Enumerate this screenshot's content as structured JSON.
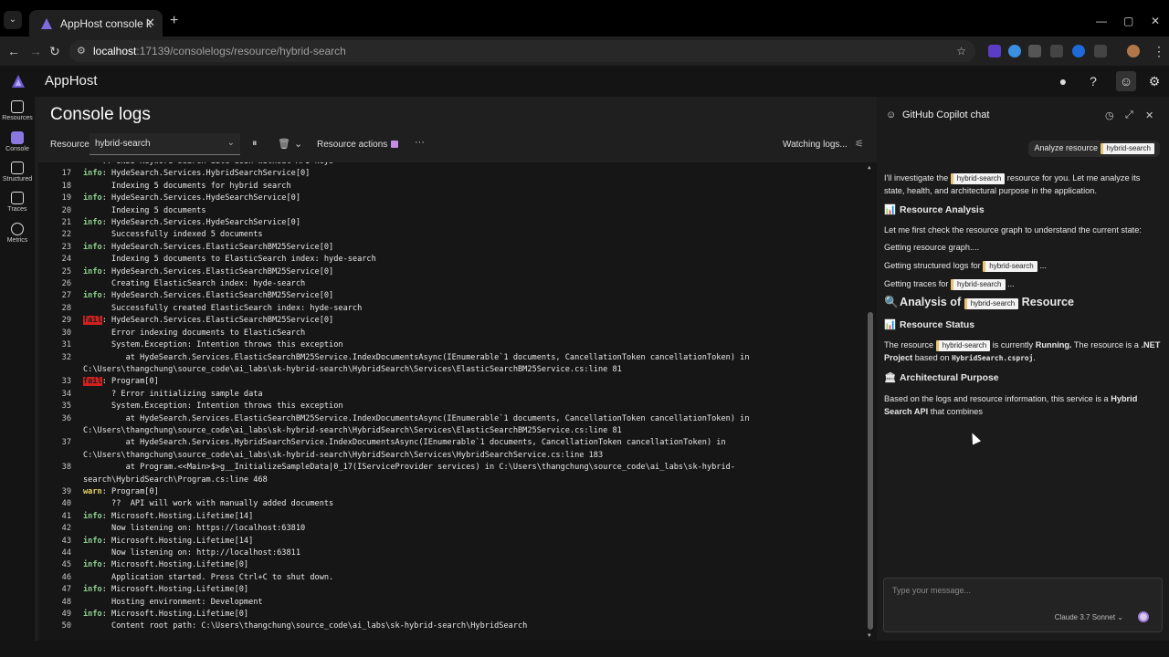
{
  "browser": {
    "tab_title": "AppHost console logs (hybrid-",
    "url_host": "localhost",
    "url_path": ":17139/consolelogs/resource/hybrid-search"
  },
  "app": {
    "name": "AppHost"
  },
  "rail": [
    {
      "label": "Resources",
      "icon": "resources-icon"
    },
    {
      "label": "Console",
      "icon": "console-icon"
    },
    {
      "label": "Structured",
      "icon": "structured-icon"
    },
    {
      "label": "Traces",
      "icon": "traces-icon"
    },
    {
      "label": "Metrics",
      "icon": "metrics-icon"
    }
  ],
  "main": {
    "title": "Console logs",
    "resource_label": "Resource",
    "resource_value": "hybrid-search",
    "resource_actions": "Resource actions",
    "watching": "Watching logs..."
  },
  "logs": [
    {
      "n": "",
      "t": "    ?? UNDS Keyword search aite doin without API keys"
    },
    {
      "n": "17",
      "lv": "info",
      "t": ": HydeSearch.Services.HybridSearchService[0]"
    },
    {
      "n": "18",
      "t": "      Indexing 5 documents for hybrid search"
    },
    {
      "n": "19",
      "lv": "info",
      "t": ": HydeSearch.Services.HydeSearchService[0]"
    },
    {
      "n": "20",
      "t": "      Indexing 5 documents"
    },
    {
      "n": "21",
      "lv": "info",
      "t": ": HydeSearch.Services.HydeSearchService[0]"
    },
    {
      "n": "22",
      "t": "      Successfully indexed 5 documents"
    },
    {
      "n": "23",
      "lv": "info",
      "t": ": HydeSearch.Services.ElasticSearchBM25Service[0]"
    },
    {
      "n": "24",
      "t": "      Indexing 5 documents to ElasticSearch index: hyde-search"
    },
    {
      "n": "25",
      "lv": "info",
      "t": ": HydeSearch.Services.ElasticSearchBM25Service[0]"
    },
    {
      "n": "26",
      "t": "      Creating ElasticSearch index: hyde-search"
    },
    {
      "n": "27",
      "lv": "info",
      "t": ": HydeSearch.Services.ElasticSearchBM25Service[0]"
    },
    {
      "n": "28",
      "t": "      Successfully created ElasticSearch index: hyde-search"
    },
    {
      "n": "29",
      "lv": "fail",
      "t": ": HydeSearch.Services.ElasticSearchBM25Service[0]"
    },
    {
      "n": "30",
      "t": "      Error indexing documents to ElasticSearch"
    },
    {
      "n": "31",
      "t": "      System.Exception: Intention throws this exception"
    },
    {
      "n": "32",
      "t": "         at HydeSearch.Services.ElasticSearchBM25Service.IndexDocumentsAsync(IEnumerable`1 documents, CancellationToken cancellationToken) in C:\\Users\\thangchung\\source_code\\ai_labs\\sk-hybrid-search\\HybridSearch\\Services\\ElasticSearchBM25Service.cs:line 81"
    },
    {
      "n": "33",
      "lv": "fail",
      "t": ": Program[0]"
    },
    {
      "n": "34",
      "t": "      ? Error initializing sample data"
    },
    {
      "n": "35",
      "t": "      System.Exception: Intention throws this exception"
    },
    {
      "n": "36",
      "t": "         at HydeSearch.Services.ElasticSearchBM25Service.IndexDocumentsAsync(IEnumerable`1 documents, CancellationToken cancellationToken) in C:\\Users\\thangchung\\source_code\\ai_labs\\sk-hybrid-search\\HybridSearch\\Services\\ElasticSearchBM25Service.cs:line 81"
    },
    {
      "n": "37",
      "t": "         at HydeSearch.Services.HybridSearchService.IndexDocumentsAsync(IEnumerable`1 documents, CancellationToken cancellationToken) in C:\\Users\\thangchung\\source_code\\ai_labs\\sk-hybrid-search\\HybridSearch\\Services\\HybridSearchService.cs:line 183"
    },
    {
      "n": "38",
      "t": "         at Program.<<Main>$>g__InitializeSampleData|0_17(IServiceProvider services) in C:\\Users\\thangchung\\source_code\\ai_labs\\sk-hybrid-search\\HybridSearch\\Program.cs:line 468"
    },
    {
      "n": "39",
      "lv": "warn",
      "t": ": Program[0]"
    },
    {
      "n": "40",
      "t": "      ??  API will work with manually added documents"
    },
    {
      "n": "41",
      "lv": "info",
      "t": ": Microsoft.Hosting.Lifetime[14]"
    },
    {
      "n": "42",
      "t": "      Now listening on: https://localhost:63810"
    },
    {
      "n": "43",
      "lv": "info",
      "t": ": Microsoft.Hosting.Lifetime[14]"
    },
    {
      "n": "44",
      "t": "      Now listening on: http://localhost:63811"
    },
    {
      "n": "45",
      "lv": "info",
      "t": ": Microsoft.Hosting.Lifetime[0]"
    },
    {
      "n": "46",
      "t": "      Application started. Press Ctrl+C to shut down."
    },
    {
      "n": "47",
      "lv": "info",
      "t": ": Microsoft.Hosting.Lifetime[0]"
    },
    {
      "n": "48",
      "t": "      Hosting environment: Development"
    },
    {
      "n": "49",
      "lv": "info",
      "t": ": Microsoft.Hosting.Lifetime[0]"
    },
    {
      "n": "50",
      "t": "      Content root path: C:\\Users\\thangchung\\source_code\\ai_labs\\sk-hybrid-search\\HybridSearch"
    }
  ],
  "copilot": {
    "title": "GitHub Copilot chat",
    "user_msg": "Analyze resource",
    "resource": "hybrid-search",
    "p1a": "I'll investigate the",
    "p1b": "resource for you. Let me analyze its state, health, and architectural purpose in the application.",
    "h_analysis": "Resource Analysis",
    "p2": "Let me first check the resource graph to understand the current state:",
    "p3": "Getting resource graph....",
    "p4a": "Getting structured logs for",
    "p4b": "...",
    "p5a": "Getting traces for",
    "p5b": "...",
    "h_big_a": "Analysis of",
    "h_big_b": "Resource",
    "h_status": "Resource Status",
    "p6a": "The resource",
    "p6b": "is currently",
    "p6c": "Running.",
    "p6d": "The resource is a",
    "p6e": ".NET Project",
    "p6f": "based on",
    "p6g": "HybridSearch.csproj",
    "h_arch": "Architectural Purpose",
    "p7a": "Based on the logs and resource information, this service is a",
    "p7b": "Hybrid Search API",
    "p7c": "that combines",
    "placeholder": "Type your message...",
    "model": "Claude 3.7 Sonnet"
  }
}
